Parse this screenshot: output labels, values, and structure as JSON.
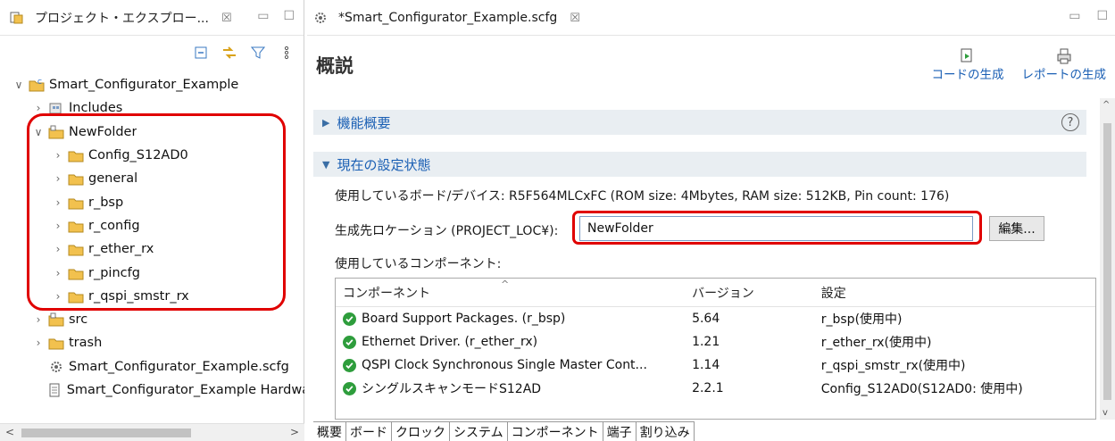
{
  "explorer": {
    "title": "プロジェクト・エクスプロー...",
    "close": "☒",
    "tree": [
      {
        "id": "root",
        "depth": 0,
        "state": "open",
        "icon": "project-icon",
        "label": "Smart_Configurator_Example"
      },
      {
        "id": "includes",
        "depth": 1,
        "state": "closed",
        "icon": "includes-icon",
        "label": "Includes"
      },
      {
        "id": "newfolder",
        "depth": 1,
        "state": "open",
        "icon": "src-folder-icon",
        "label": "NewFolder"
      },
      {
        "id": "config",
        "depth": 2,
        "state": "closed",
        "icon": "folder-icon",
        "label": "Config_S12AD0"
      },
      {
        "id": "general",
        "depth": 2,
        "state": "closed",
        "icon": "folder-icon",
        "label": "general"
      },
      {
        "id": "rbsp",
        "depth": 2,
        "state": "closed",
        "icon": "folder-icon",
        "label": "r_bsp"
      },
      {
        "id": "rconfig",
        "depth": 2,
        "state": "closed",
        "icon": "folder-icon",
        "label": "r_config"
      },
      {
        "id": "rether",
        "depth": 2,
        "state": "closed",
        "icon": "folder-icon",
        "label": "r_ether_rx"
      },
      {
        "id": "rpincfg",
        "depth": 2,
        "state": "closed",
        "icon": "folder-icon",
        "label": "r_pincfg"
      },
      {
        "id": "rqspi",
        "depth": 2,
        "state": "closed",
        "icon": "folder-icon",
        "label": "r_qspi_smstr_rx"
      },
      {
        "id": "src",
        "depth": 1,
        "state": "closed",
        "icon": "src-folder-icon",
        "label": "src"
      },
      {
        "id": "trash",
        "depth": 1,
        "state": "closed",
        "icon": "folder-icon",
        "label": "trash"
      },
      {
        "id": "scfg",
        "depth": 1,
        "state": "none",
        "icon": "gear-file-icon",
        "label": "Smart_Configurator_Example.scfg"
      },
      {
        "id": "hw",
        "depth": 1,
        "state": "none",
        "icon": "document-icon",
        "label": "Smart_Configurator_Example Hardware"
      }
    ]
  },
  "editor": {
    "tab_label": "*Smart_Configurator_Example.scfg",
    "tab_close": "☒",
    "page_title": "概説",
    "gen_code": "コードの生成",
    "gen_report": "レポートの生成",
    "section_features": "機能概要",
    "section_status": "現在の設定状態",
    "board_label": "使用しているボード/デバイス:",
    "board_value": "R5F564MLCxFC (ROM size: 4Mbytes, RAM size: 512KB, Pin count: 176)",
    "location_label": "生成先ロケーション (PROJECT_LOC¥):",
    "location_value": "NewFolder",
    "edit_button": "編集...",
    "components_label": "使用しているコンポーネント:",
    "table": {
      "headers": [
        "コンポーネント",
        "バージョン",
        "設定"
      ],
      "rows": [
        {
          "name": "Board Support Packages. (r_bsp)",
          "version": "5.64",
          "setting": "r_bsp(使用中)"
        },
        {
          "name": "Ethernet Driver. (r_ether_rx)",
          "version": "1.21",
          "setting": "r_ether_rx(使用中)"
        },
        {
          "name": "QSPI Clock Synchronous Single Master Cont...",
          "version": "1.14",
          "setting": "r_qspi_smstr_rx(使用中)"
        },
        {
          "name": "シングルスキャンモードS12AD",
          "version": "2.2.1",
          "setting": "Config_S12AD0(S12AD0: 使用中)"
        }
      ]
    },
    "bottom_tabs": [
      "概要",
      "ボード",
      "クロック",
      "システム",
      "コンポーネント",
      "端子",
      "割り込み"
    ]
  },
  "colors": {
    "highlight_red": "#e00000",
    "link_blue": "#1a5fb4",
    "folder_yellow": "#f2c14e",
    "ok_green": "#2e9d3c"
  }
}
